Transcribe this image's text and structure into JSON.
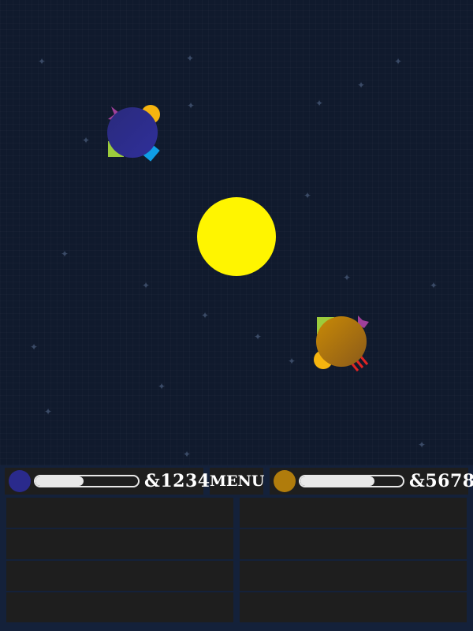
{
  "players": [
    {
      "score": "&1234",
      "energy": 0.47,
      "color": "#2a2a8c",
      "planet_gradient": [
        "#2a2a8c",
        "#2e2e99"
      ]
    },
    {
      "score": "&5678",
      "energy": 0.72,
      "color": "#b07c0c",
      "planet_gradient": [
        "#c98a05",
        "#8a5a1a"
      ]
    }
  ],
  "menu_label": "MENU",
  "colors": {
    "background": "#101a2d",
    "sun": "#fff500",
    "hud_panel": "#1e1e1e",
    "attachment_yellow": "#f5b40f",
    "attachment_green": "#9ccc3c",
    "attachment_blue": "#0f9ee6",
    "attachment_magenta": "#a0409a",
    "attachment_red": "#e02424",
    "star": "#3a4a66"
  },
  "icons": [
    "sparkle-star-icon",
    "planet-icon",
    "sun-icon"
  ]
}
